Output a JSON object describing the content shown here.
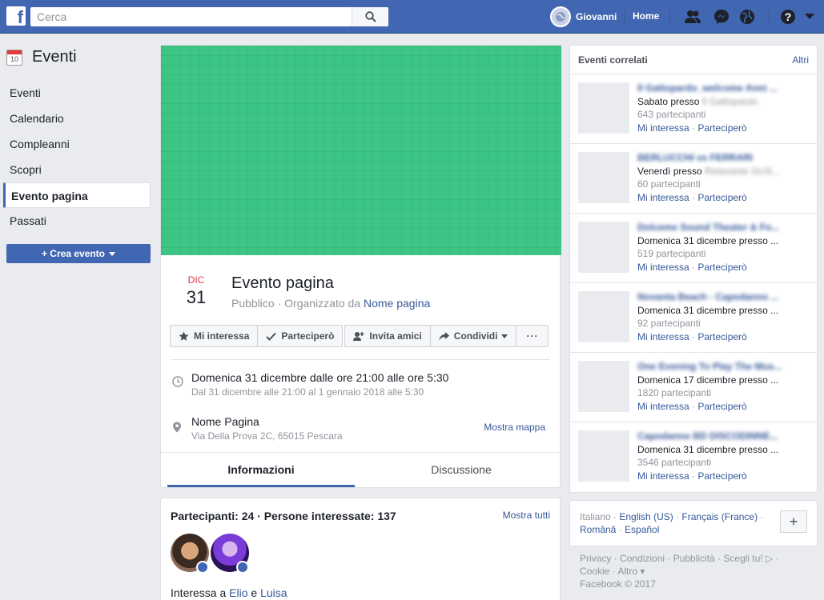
{
  "topbar": {
    "logo": "f",
    "search_placeholder": "Cerca",
    "user_name": "Giovanni",
    "home_label": "Home",
    "help_label": "?"
  },
  "sidebar": {
    "title": "Eventi",
    "calendar_day": "10",
    "items": [
      {
        "label": "Eventi"
      },
      {
        "label": "Calendario"
      },
      {
        "label": "Compleanni"
      },
      {
        "label": "Scopri"
      },
      {
        "label": "Evento pagina"
      },
      {
        "label": "Passati"
      }
    ],
    "create_button": "+ Crea evento"
  },
  "event": {
    "cover_color": "#3dc585",
    "month": "DIC",
    "day": "31",
    "name": "Evento pagina",
    "privacy": "Pubblico",
    "organized_by": " · Organizzato da ",
    "page_name": "Nome pagina",
    "actions": {
      "interested": "Mi interessa",
      "going": "Parteciperò",
      "invite": "Invita amici",
      "share": "Condividi",
      "more": "···"
    },
    "time_main": "Domenica 31 dicembre dalle ore 21:00 alle ore 5:30",
    "time_sub": "Dal 31 dicembre alle 21:00 al 1 gennaio 2018 alle 5:30",
    "place_main": "Nome Pagina",
    "place_sub": "Via Della Prova 2C, 65015 Pescara",
    "map_link": "Mostra mappa",
    "tabs": [
      "Informazioni",
      "Discussione"
    ]
  },
  "participants": {
    "title": "Partecipanti: 24 · Persone interessate: 137",
    "show_all": "Mostra tutti",
    "interest_prefix": "Interessa a ",
    "friend1": "Elio",
    "conj": " e ",
    "friend2": "Luisa"
  },
  "related": {
    "title": "Eventi correlati",
    "more": "Altri",
    "interested": "Mi interessa",
    "dot": " · ",
    "going": "Parteciperò",
    "items": [
      {
        "name": "Il Gattopardo_welcome Anni ...",
        "when": "Sabato presso ",
        "where": "Il Gattopardo",
        "count": "643 partecipanti"
      },
      {
        "name": "BERLUCCHI vs FERRARI",
        "when": "Venerdì presso ",
        "where": "Ristorante GUS...",
        "count": "60 partecipanti"
      },
      {
        "name": "Dolceme Sound Theater & Fo...",
        "when": "Domenica 31 dicembre presso ...",
        "where": "",
        "count": "519 partecipanti"
      },
      {
        "name": "Novanta Beach - Capodanno ...",
        "when": "Domenica 31 dicembre presso ...",
        "where": "",
        "count": "92 partecipanti"
      },
      {
        "name": "One Evening To Play The Mus...",
        "when": "Domenica 17 dicembre presso ...",
        "where": "",
        "count": "1820 partecipanti"
      },
      {
        "name": "Capodanno BD DISCODINNE...",
        "when": "Domenica 31 dicembre presso ...",
        "where": "",
        "count": "3546 partecipanti"
      }
    ]
  },
  "languages": {
    "current": "Italiano",
    "dot": " · ",
    "l1": "English (US)",
    "l2": "Français (France)",
    "l3": "Română",
    "l4": "Español",
    "plus": "+"
  },
  "footer": {
    "line1": "Privacy · Condizioni · Pubblicità · Scegli tu! ▷ ·",
    "line2": "Cookie · Altro ▾",
    "line3": "Facebook © 2017"
  }
}
